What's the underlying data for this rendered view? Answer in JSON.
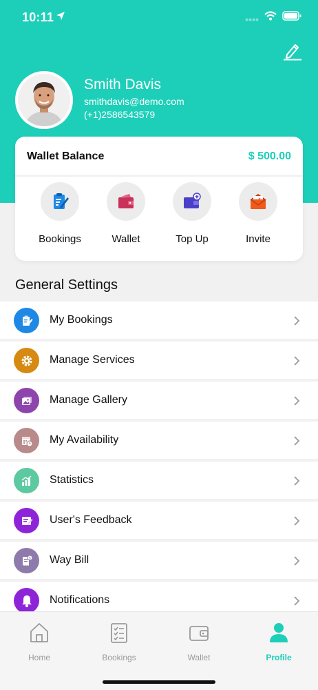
{
  "status_bar": {
    "time": "10:11",
    "icons": [
      "location-arrow-icon",
      "signal-dots-icon",
      "wifi-icon",
      "battery-icon"
    ]
  },
  "header": {
    "edit_icon": "pencil-edit-icon",
    "background_color": "#1dcfb9"
  },
  "profile": {
    "name": "Smith Davis",
    "email": "smithdavis@demo.com",
    "phone": "(+1)2586543579"
  },
  "wallet": {
    "title": "Wallet Balance",
    "amount": "$ 500.00",
    "amount_color": "#1dcfb9",
    "actions": [
      {
        "label": "Bookings",
        "icon": "clipboard-icon"
      },
      {
        "label": "Wallet",
        "icon": "wallet-icon"
      },
      {
        "label": "Top Up",
        "icon": "card-plus-icon"
      },
      {
        "label": "Invite",
        "icon": "envelope-icon"
      }
    ]
  },
  "general_settings": {
    "title": "General Settings",
    "items": [
      {
        "label": "My Bookings",
        "icon": "clipboard-icon",
        "color": "#1e88e5"
      },
      {
        "label": "Manage Services",
        "icon": "gear-icon",
        "color": "#d68a12"
      },
      {
        "label": "Manage Gallery",
        "icon": "gallery-icon",
        "color": "#8e44ad"
      },
      {
        "label": "My Availability",
        "icon": "calendar-clock-icon",
        "color": "#b98a8a"
      },
      {
        "label": "Statistics",
        "icon": "bar-chart-icon",
        "color": "#5cc9a0"
      },
      {
        "label": "User's Feedback",
        "icon": "feedback-icon",
        "color": "#8e24d8"
      },
      {
        "label": "Way Bill",
        "icon": "bill-icon",
        "color": "#8e7bab"
      },
      {
        "label": "Notifications",
        "icon": "bell-icon",
        "color": "#8e24d8"
      }
    ]
  },
  "bottom_nav": {
    "items": [
      {
        "label": "Home",
        "icon": "home-icon",
        "active": false
      },
      {
        "label": "Bookings",
        "icon": "checklist-icon",
        "active": false
      },
      {
        "label": "Wallet",
        "icon": "wallet-icon",
        "active": false
      },
      {
        "label": "Profile",
        "icon": "person-icon",
        "active": true
      }
    ],
    "active_color": "#1dcfb9"
  }
}
